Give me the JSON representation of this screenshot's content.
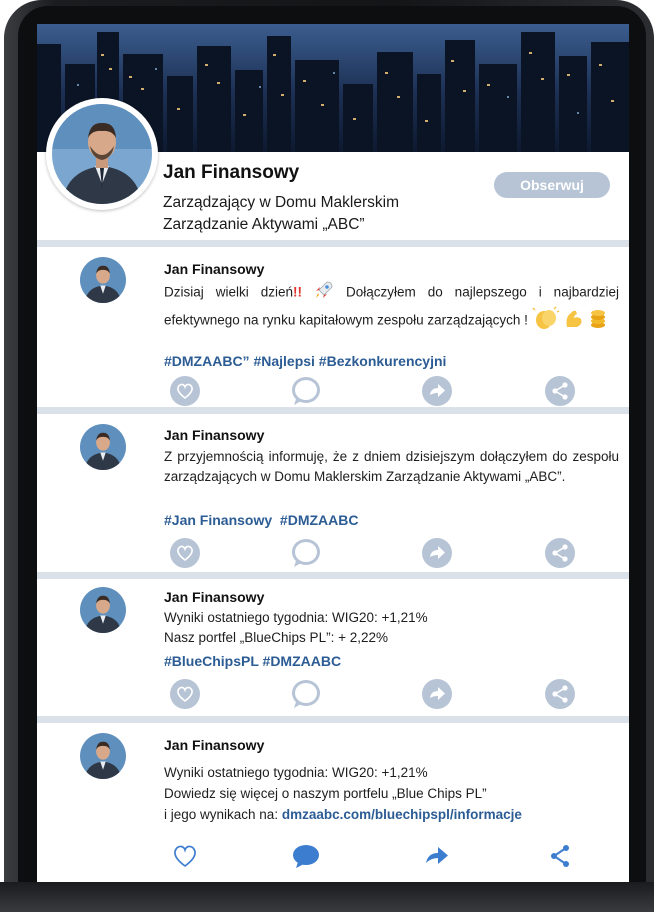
{
  "profile": {
    "name": "Jan Finansowy",
    "role": "Zarządzający w Domu Maklerskim Zarządzanie Aktywami „ABC”",
    "follow_label": "Obserwuj"
  },
  "posts": [
    {
      "author": "Jan Finansowy",
      "text_1": "Dzisiaj wielki dzień",
      "text_exclaim": "!!",
      "text_2": "Dołączyłem do najlepszego i najbardziej efektywnego na rynku kapitałowym zespołu zarządzających !",
      "tags": "#DMZAABC” #Najlepsi #Bezkonkurencyjni",
      "emojis": [
        "rocket-icon",
        "clapping-hands-icon",
        "flexed-biceps-icon",
        "coins-icon"
      ]
    },
    {
      "author": "Jan Finansowy",
      "text": "Z przyjemnością informuję, że z dniem dzisiejszym dołączyłem do zespołu zarządzających w Domu Maklerskim Zarządzanie Aktywami „ABC”.",
      "tags": "#Jan Finansowy  #DMZAABC"
    },
    {
      "author": "Jan Finansowy",
      "line_1": "Wyniki ostatniego tygodnia: WIG20: +1,21%",
      "line_2": "Nasz portfel „BlueChips PL”: + 2,22%",
      "tags": "#BlueChipsPL #DMZAABC"
    },
    {
      "author": "Jan Finansowy",
      "line_1": "Wyniki ostatniego tygodnia: WIG20: +1,21%",
      "line_2": "Dowiedz się więcej o naszym portfelu „Blue Chips PL”",
      "line_3_prefix": "i jego wynikach na: ",
      "link": "dmzaabc.com/bluechipspl/informacje"
    }
  ],
  "actions": [
    "heart-icon",
    "comment-icon",
    "share-arrow-icon",
    "share-network-icon"
  ],
  "colors": {
    "accent": "#2c5c94",
    "inactive_icon": "#b7c4d6",
    "active_icon": "#3d7dcf",
    "divider": "#dbe1e8",
    "follow_button": "#b7c4d6"
  }
}
